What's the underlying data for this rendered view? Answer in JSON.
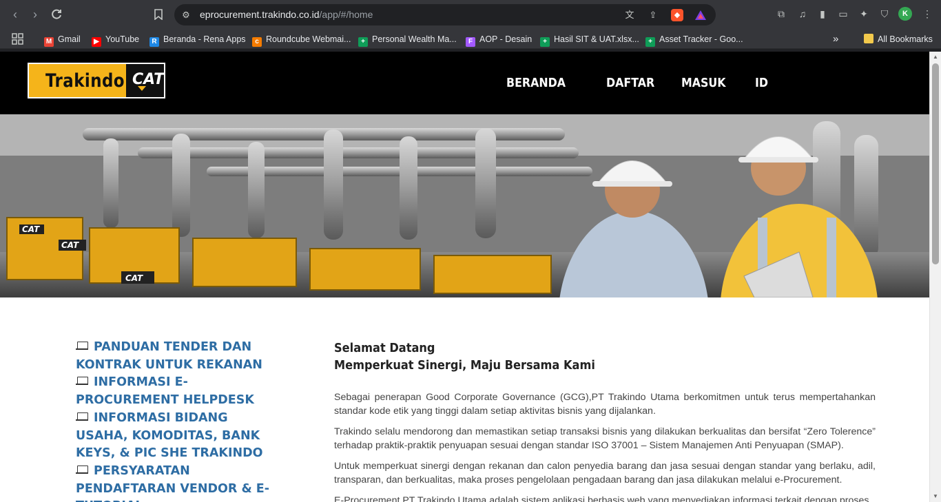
{
  "browser": {
    "url_host": "eprocurement.trakindo.co.id",
    "url_path": "/app/#/home",
    "bookmarks": [
      {
        "label": "Gmail",
        "color": "#ea4335",
        "glyph": "M"
      },
      {
        "label": "YouTube",
        "color": "#ff0000",
        "glyph": "▶"
      },
      {
        "label": "Beranda - Rena Apps",
        "color": "#1e88e5",
        "glyph": "R"
      },
      {
        "label": "Roundcube Webmai...",
        "color": "#f57c00",
        "glyph": "c"
      },
      {
        "label": "Personal Wealth Ma...",
        "color": "#0f9d58",
        "glyph": "+"
      },
      {
        "label": "AOP - Desain",
        "color": "#a259ff",
        "glyph": "F"
      },
      {
        "label": "Hasil SIT & UAT.xlsx...",
        "color": "#0f9d58",
        "glyph": "+"
      },
      {
        "label": "Asset Tracker - Goo...",
        "color": "#0f9d58",
        "glyph": "+"
      }
    ],
    "all_bookmarks": "All Bookmarks",
    "more_glyph": "»"
  },
  "site": {
    "logo_text": "Trakindo",
    "logo_brand": "CAT",
    "menu": [
      "BERANDA",
      "DAFTAR",
      "MASUK",
      "ID"
    ]
  },
  "sidebar": {
    "links": [
      "PANDUAN TENDER DAN KONTRAK UNTUK REKANAN",
      "INFORMASI E-PROCUREMENT HELPDESK",
      "INFORMASI BIDANG USAHA, KOMODITAS, BANK KEYS, & PIC SHE TRAKINDO",
      "PERSYARATAN PENDAFTARAN VENDOR & E-TUTORIAL"
    ]
  },
  "main": {
    "title_line1": "Selamat Datang",
    "title_line2": "Memperkuat Sinergi, Maju Bersama Kami",
    "paragraphs": [
      "Sebagai penerapan Good Corporate Governance (GCG),PT Trakindo Utama berkomitmen untuk terus mempertahankan standar kode etik yang tinggi dalam setiap aktivitas bisnis yang dijalankan.",
      "Trakindo selalu mendorong dan memastikan setiap transaksi bisnis yang dilakukan berkualitas dan bersifat “Zero Tolerence” terhadap praktik-praktik penyuapan sesuai dengan standar ISO 37001 – Sistem Manajemen Anti Penyuapan (SMAP).",
      "Untuk memperkuat sinergi dengan rekanan dan calon penyedia barang dan jasa sesuai dengan standar yang berlaku, adil, transparan, dan berkualitas, maka proses pengelolaan pengadaan barang dan jasa dilakukan melalui e-Procurement.",
      "E-Procurement PT Trakindo Utama adalah sistem aplikasi berbasis web yang menyediakan informasi terkait dengan proses"
    ]
  },
  "colors": {
    "brand_yellow": "#f5b41a",
    "link_blue": "#2e6da4",
    "header_black": "#000000"
  }
}
